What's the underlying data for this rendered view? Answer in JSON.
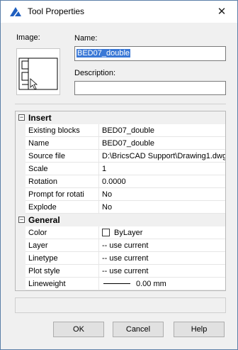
{
  "dialog": {
    "title": "Tool Properties",
    "close_glyph": "✕"
  },
  "image_label": "Image:",
  "name": {
    "label": "Name:",
    "value": "BED07_double"
  },
  "description": {
    "label": "Description:",
    "value": ""
  },
  "categories": [
    {
      "label": "Insert",
      "expander": "−"
    },
    {
      "label": "General",
      "expander": "−"
    }
  ],
  "insert_props": [
    {
      "name": "Existing blocks",
      "value": "BED07_double"
    },
    {
      "name": "Name",
      "value": "BED07_double"
    },
    {
      "name": "Source file",
      "value": "D:\\BricsCAD Support\\Drawing1.dwg"
    },
    {
      "name": "Scale",
      "value": "1"
    },
    {
      "name": "Rotation",
      "value": "0.0000"
    },
    {
      "name": "Prompt for rotati",
      "value": "No"
    },
    {
      "name": "Explode",
      "value": "No"
    }
  ],
  "general_props": [
    {
      "name": "Color",
      "value": "ByLayer",
      "icon": "color-swatch-icon"
    },
    {
      "name": "Layer",
      "value": "-- use current"
    },
    {
      "name": "Linetype",
      "value": "-- use current"
    },
    {
      "name": "Plot style",
      "value": "-- use current"
    },
    {
      "name": "Lineweight",
      "value": "0.00 mm",
      "icon": "lineweight-line-icon"
    }
  ],
  "buttons": {
    "ok": "OK",
    "cancel": "Cancel",
    "help": "Help"
  },
  "colors": {
    "accent": "#3a78d6",
    "app_icon": "#1f5fbf"
  }
}
